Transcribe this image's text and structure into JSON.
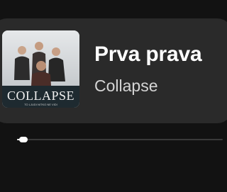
{
  "now_playing": {
    "title": "Prva prava",
    "artist": "Collapse",
    "album_art": {
      "icon": "album-cover-art",
      "band_text": "COLLAPSE",
      "sub_text": "TO LJUDI NITKO NE VIDI"
    }
  },
  "playback": {
    "progress_fraction": 0.03
  },
  "colors": {
    "background": "#121212",
    "card": "#2a2a2a",
    "title": "#ffffff",
    "artist": "#d5d5d5",
    "progress_track": "#3a3a3a",
    "progress_fill": "#ffffff"
  }
}
